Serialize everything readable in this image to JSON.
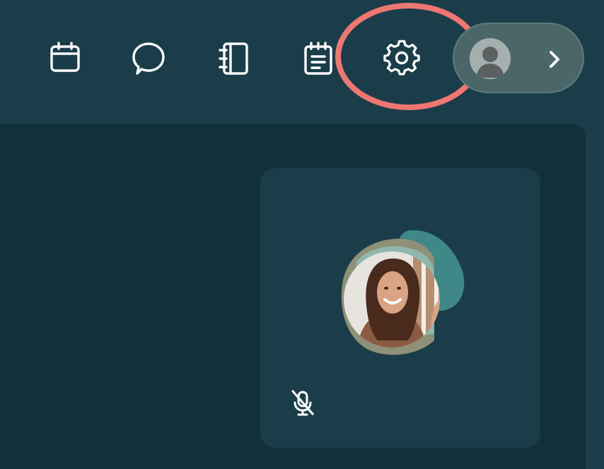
{
  "toolbar": {
    "tools": [
      {
        "icon": "calendar-icon"
      },
      {
        "icon": "chat-bubble-icon"
      },
      {
        "icon": "notebook-icon"
      },
      {
        "icon": "notepad-icon"
      },
      {
        "icon": "gear-icon"
      }
    ]
  },
  "annotation": {
    "color": "#ef7672",
    "target": "gear-icon"
  },
  "profile": {
    "avatar_icon": "user-avatar-icon",
    "chevron_icon": "chevron-right-icon"
  },
  "participant_tile": {
    "microphone_state": "muted",
    "mute_icon": "microphone-off-icon"
  },
  "colors": {
    "background": "#1b3d49",
    "stage": "#11303b",
    "tile": "#1b3d49",
    "annotation": "#ef7672",
    "icon": "#ffffff"
  }
}
